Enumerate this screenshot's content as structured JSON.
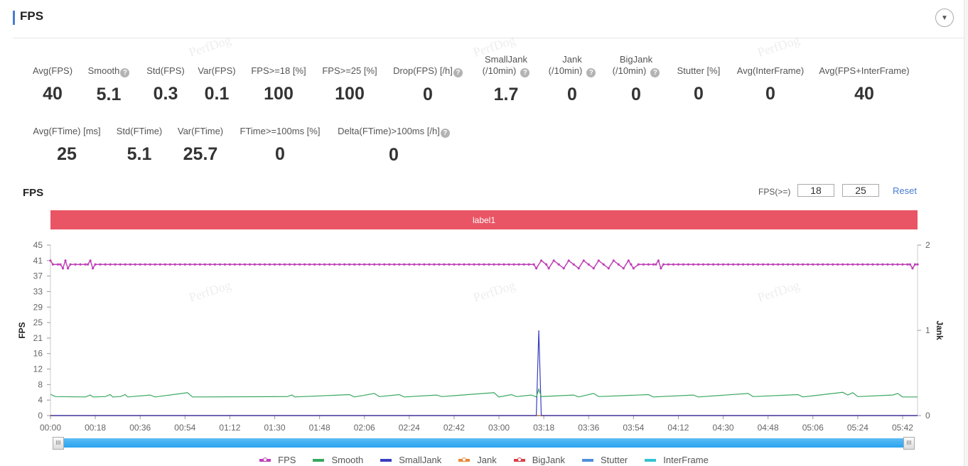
{
  "header": {
    "title": "FPS",
    "collapse_icon": "▼"
  },
  "watermark": "PerfDog",
  "stats_row1": [
    {
      "label": "Avg(FPS)",
      "value": "40",
      "help": false
    },
    {
      "label": "Smooth",
      "value": "5.1",
      "help": true
    },
    {
      "label": "Std(FPS)",
      "value": "0.3",
      "help": false
    },
    {
      "label": "Var(FPS)",
      "value": "0.1",
      "help": false
    },
    {
      "label": "FPS>=18 [%]",
      "value": "100",
      "help": false
    },
    {
      "label": "FPS>=25 [%]",
      "value": "100",
      "help": false
    },
    {
      "label": "Drop(FPS) [/h]",
      "value": "0",
      "help": true
    },
    {
      "label": "SmallJank",
      "label2": "(/10min)",
      "value": "1.7",
      "help": true
    },
    {
      "label": "Jank",
      "label2": "(/10min)",
      "value": "0",
      "help": true
    },
    {
      "label": "BigJank",
      "label2": "(/10min)",
      "value": "0",
      "help": true
    },
    {
      "label": "Stutter [%]",
      "value": "0",
      "help": false
    },
    {
      "label": "Avg(InterFrame)",
      "value": "0",
      "help": false
    },
    {
      "label": "Avg(FPS+InterFrame)",
      "value": "40",
      "help": false
    }
  ],
  "stats_row2": [
    {
      "label": "Avg(FTime) [ms]",
      "value": "25",
      "help": false
    },
    {
      "label": "Std(FTime)",
      "value": "5.1",
      "help": false
    },
    {
      "label": "Var(FTime)",
      "value": "25.7",
      "help": false
    },
    {
      "label": "FTime>=100ms [%]",
      "value": "0",
      "help": false
    },
    {
      "label": "Delta(FTime)>100ms [/h]",
      "value": "0",
      "help": true
    }
  ],
  "help_icon": "?",
  "chart_section": {
    "title": "FPS",
    "threshold_label": "FPS(>=)",
    "threshold1": "18",
    "threshold2": "25",
    "reset_label": "Reset",
    "label_bar": "label1",
    "label_bar_color": "#e95564"
  },
  "scrollbar": {
    "handle_glyph": "III",
    "range_start": 0,
    "range_end": 1
  },
  "chart_data": {
    "type": "line",
    "title": "FPS",
    "xlabel": "",
    "ylabel": "FPS",
    "y2label": "Jank",
    "ylim": [
      0,
      45
    ],
    "y2lim": [
      0,
      2
    ],
    "yticks": [
      0,
      4,
      8,
      12,
      16,
      21,
      25,
      29,
      33,
      37,
      41,
      45
    ],
    "y2ticks": [
      0,
      1,
      2
    ],
    "xticks": [
      "00:00",
      "00:18",
      "00:36",
      "00:54",
      "01:12",
      "01:30",
      "01:48",
      "02:06",
      "02:24",
      "02:42",
      "03:00",
      "03:18",
      "03:36",
      "03:54",
      "04:12",
      "04:30",
      "04:48",
      "05:06",
      "05:24",
      "05:42"
    ],
    "x_range_seconds": [
      0,
      348
    ],
    "grid": false,
    "legend_position": "bottom",
    "series": [
      {
        "name": "FPS",
        "color": "#c040b8",
        "axis": "left",
        "markers": true,
        "baseline": 40,
        "points": [
          [
            0,
            41
          ],
          [
            1,
            40
          ],
          [
            3,
            40
          ],
          [
            4,
            40
          ],
          [
            5,
            39
          ],
          [
            6,
            41
          ],
          [
            7,
            39
          ],
          [
            8,
            40
          ],
          [
            15,
            40
          ],
          [
            16,
            41
          ],
          [
            17,
            39
          ],
          [
            18,
            40
          ],
          [
            194,
            40
          ],
          [
            195,
            39
          ],
          [
            197,
            41
          ],
          [
            199,
            40
          ],
          [
            200,
            39
          ],
          [
            202,
            41
          ],
          [
            204,
            40
          ],
          [
            206,
            39
          ],
          [
            208,
            41
          ],
          [
            210,
            40
          ],
          [
            212,
            39
          ],
          [
            214,
            41
          ],
          [
            216,
            40
          ],
          [
            218,
            39
          ],
          [
            220,
            41
          ],
          [
            222,
            40
          ],
          [
            224,
            39
          ],
          [
            226,
            41
          ],
          [
            228,
            40
          ],
          [
            230,
            39
          ],
          [
            232,
            41
          ],
          [
            233,
            40
          ],
          [
            234,
            39
          ],
          [
            236,
            40
          ],
          [
            243,
            40
          ],
          [
            244,
            41
          ],
          [
            245,
            39
          ],
          [
            246,
            40
          ],
          [
            345,
            40
          ],
          [
            346,
            39
          ],
          [
            347,
            40
          ],
          [
            348,
            40
          ]
        ]
      },
      {
        "name": "Smooth",
        "color": "#3aa860",
        "axis": "left",
        "markers": false,
        "baseline": 4.8,
        "points": [
          [
            0,
            5.5
          ],
          [
            2,
            4.9
          ],
          [
            14,
            4.8
          ],
          [
            16,
            5.3
          ],
          [
            17,
            4.8
          ],
          [
            22,
            4.9
          ],
          [
            24,
            5.4
          ],
          [
            25,
            4.8
          ],
          [
            28,
            4.9
          ],
          [
            30,
            5.4
          ],
          [
            31,
            4.8
          ],
          [
            40,
            5.3
          ],
          [
            42,
            4.8
          ],
          [
            55,
            5.9
          ],
          [
            57,
            4.8
          ],
          [
            95,
            4.9
          ],
          [
            97,
            5.3
          ],
          [
            98,
            4.8
          ],
          [
            120,
            5.4
          ],
          [
            122,
            4.8
          ],
          [
            130,
            5.7
          ],
          [
            132,
            4.9
          ],
          [
            140,
            5.4
          ],
          [
            142,
            4.8
          ],
          [
            155,
            5.3
          ],
          [
            157,
            4.9
          ],
          [
            178,
            5.9
          ],
          [
            180,
            4.8
          ],
          [
            185,
            5.4
          ],
          [
            187,
            4.9
          ],
          [
            193,
            5.3
          ],
          [
            195,
            4.8
          ],
          [
            196,
            6.8
          ],
          [
            197,
            4.9
          ],
          [
            210,
            5.3
          ],
          [
            212,
            4.8
          ],
          [
            218,
            5.7
          ],
          [
            220,
            4.9
          ],
          [
            240,
            5.4
          ],
          [
            242,
            4.8
          ],
          [
            258,
            5.3
          ],
          [
            260,
            4.8
          ],
          [
            280,
            5.7
          ],
          [
            282,
            4.9
          ],
          [
            300,
            5.4
          ],
          [
            302,
            4.8
          ],
          [
            318,
            6.0
          ],
          [
            320,
            5.3
          ],
          [
            322,
            5.9
          ],
          [
            324,
            4.9
          ],
          [
            338,
            5.3
          ],
          [
            340,
            5.7
          ],
          [
            342,
            4.8
          ],
          [
            348,
            4.8
          ]
        ]
      },
      {
        "name": "SmallJank",
        "color": "#3b3fc0",
        "axis": "right",
        "markers": false,
        "points": [
          [
            0,
            0
          ],
          [
            195,
            0
          ],
          [
            196,
            1
          ],
          [
            197,
            0
          ],
          [
            348,
            0
          ]
        ]
      },
      {
        "name": "Jank",
        "color": "#e8893a",
        "axis": "right",
        "markers": true,
        "points": [
          [
            0,
            0
          ],
          [
            348,
            0
          ]
        ]
      },
      {
        "name": "BigJank",
        "color": "#d9404a",
        "axis": "right",
        "markers": true,
        "points": [
          [
            0,
            0
          ],
          [
            348,
            0
          ]
        ]
      },
      {
        "name": "Stutter",
        "color": "#4f8fdc",
        "axis": "right",
        "markers": false,
        "points": [
          [
            0,
            0
          ],
          [
            348,
            0
          ]
        ]
      },
      {
        "name": "InterFrame",
        "color": "#34c3d4",
        "axis": "left",
        "markers": false,
        "points": [
          [
            0,
            0
          ],
          [
            348,
            0
          ]
        ]
      }
    ]
  }
}
